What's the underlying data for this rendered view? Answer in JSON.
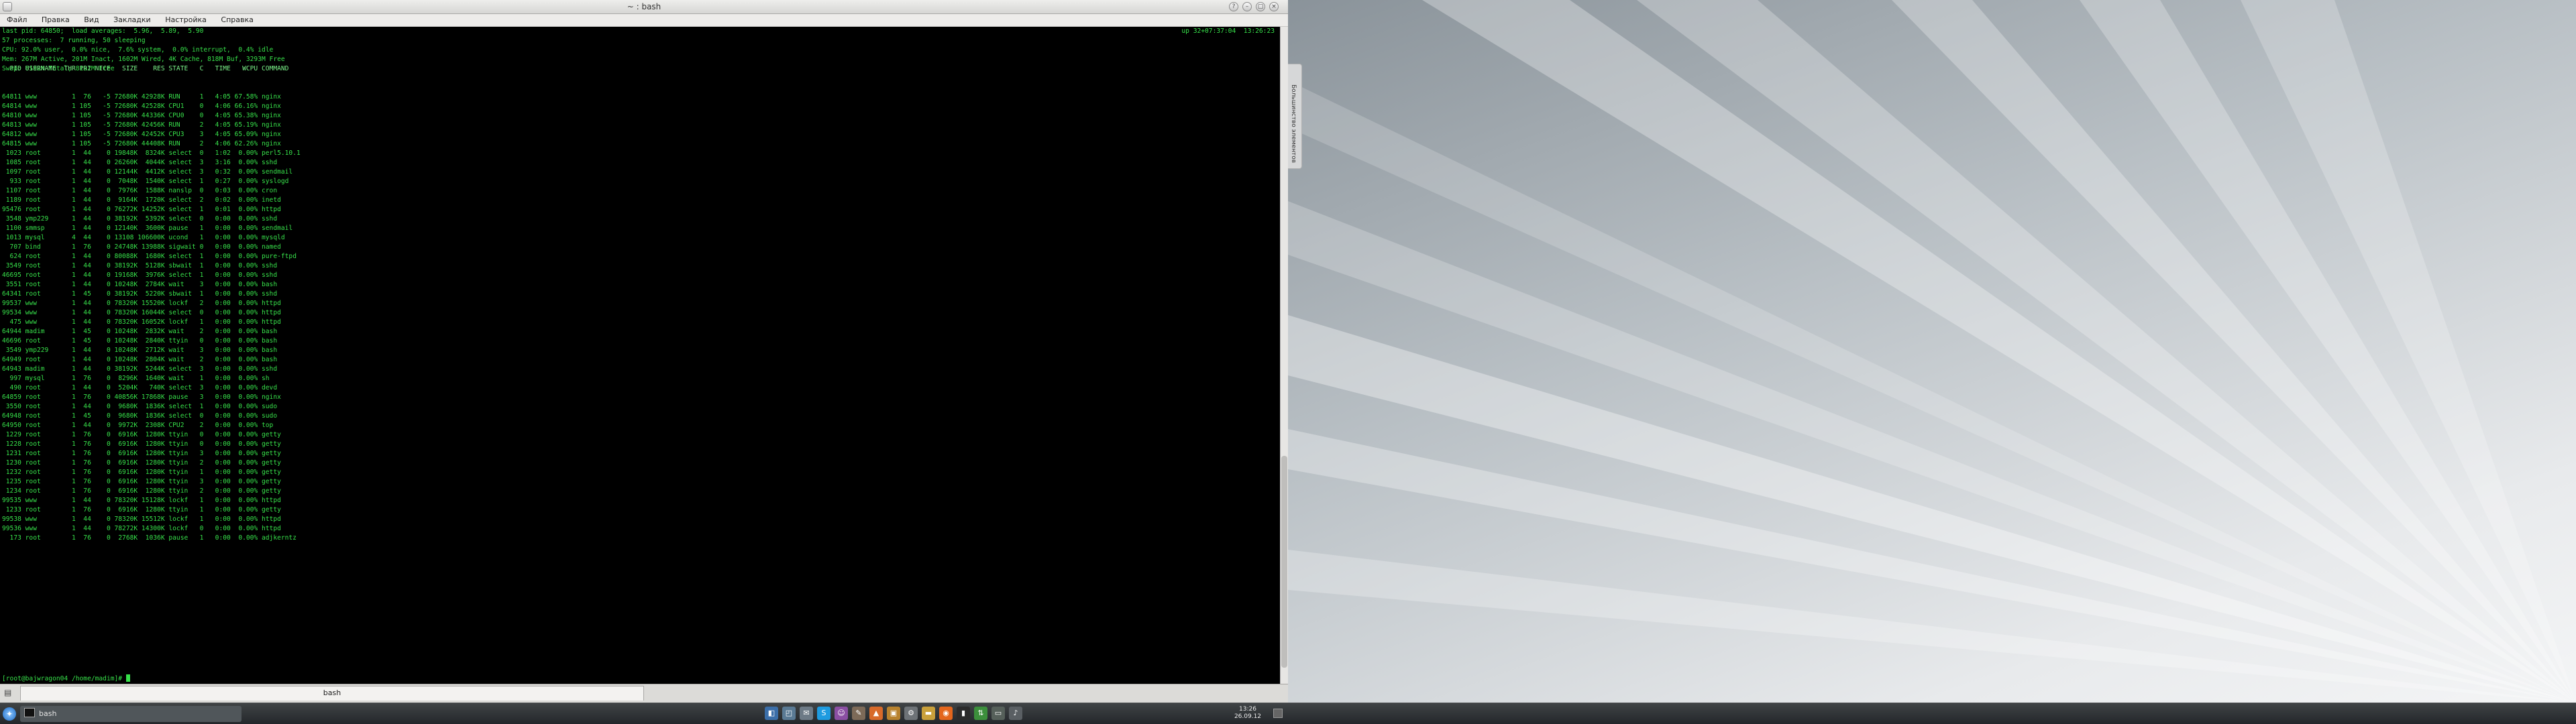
{
  "window": {
    "title": "~ : bash",
    "buttons": {
      "help": "?",
      "minimize": "–",
      "maximize": "▢",
      "close": "×"
    }
  },
  "menu": [
    "Файл",
    "Правка",
    "Вид",
    "Закладки",
    "Настройка",
    "Справка"
  ],
  "terminal": {
    "header_lines": [
      "last pid: 64850;  load averages:  5.96,  5.89,  5.90",
      "57 processes:  7 running, 50 sleeping",
      "CPU: 92.0% user,  0.0% nice,  7.6% system,  0.0% interrupt,  0.4% idle",
      "Mem: 267M Active, 201M Inact, 1602M Wired, 4K Cache, 818M Buf, 3293M Free",
      "Swap: 8192M Total, 8192M Free"
    ],
    "uptime": "up 32+07:37:04  13:26:23",
    "process_header": "  PID USERNAME  THR PRI NICE   SIZE    RES STATE   C   TIME   WCPU COMMAND",
    "process_rows": [
      "64811 www         1  76   -5 72680K 42928K RUN     1   4:05 67.58% nginx",
      "64814 www         1 105   -5 72680K 42528K CPU1    0   4:06 66.16% nginx",
      "64810 www         1 105   -5 72680K 44336K CPU0    0   4:05 65.38% nginx",
      "64813 www         1 105   -5 72680K 42456K RUN     2   4:05 65.19% nginx",
      "64812 www         1 105   -5 72680K 42452K CPU3    3   4:05 65.09% nginx",
      "64815 www         1 105   -5 72680K 44408K RUN     2   4:06 62.26% nginx",
      " 1023 root        1  44    0 19848K  8324K select  0   1:02  0.00% perl5.10.1",
      " 1085 root        1  44    0 26260K  4044K select  3   3:16  0.00% sshd",
      " 1097 root        1  44    0 12144K  4412K select  3   0:32  0.00% sendmail",
      "  933 root        1  44    0  7048K  1540K select  1   0:27  0.00% syslogd",
      " 1107 root        1  44    0  7976K  1588K nanslp  0   0:03  0.00% cron",
      " 1189 root        1  44    0  9164K  1720K select  2   0:02  0.00% inetd",
      "95476 root        1  44    0 76272K 14252K select  1   0:01  0.00% httpd",
      " 3548 ymp229      1  44    0 38192K  5392K select  0   0:00  0.00% sshd",
      " 1100 smmsp       1  44    0 12140K  3600K pause   1   0:00  0.00% sendmail",
      " 1013 mysql       4  44    0 13108 106600K ucond   1   0:00  0.00% mysqld",
      "  707 bind        1  76    0 24748K 13988K sigwait 0   0:00  0.00% named",
      "  624 root        1  44    0 80088K  1680K select  1   0:00  0.00% pure-ftpd",
      " 3549 root        1  44    0 38192K  5128K sbwait  1   0:00  0.00% sshd",
      "46695 root        1  44    0 19168K  3976K select  1   0:00  0.00% sshd",
      " 3551 root        1  44    0 10248K  2784K wait    3   0:00  0.00% bash",
      "64341 root        1  45    0 38192K  5220K sbwait  1   0:00  0.00% sshd",
      "99537 www         1  44    0 78320K 15520K lockf   2   0:00  0.00% httpd",
      "99534 www         1  44    0 78320K 16044K select  0   0:00  0.00% httpd",
      "  475 www         1  44    0 78320K 16052K lockf   1   0:00  0.00% httpd",
      "64944 madim       1  45    0 10248K  2832K wait    2   0:00  0.00% bash",
      "46696 root        1  45    0 10248K  2840K ttyin   0   0:00  0.00% bash",
      " 3549 ymp229      1  44    0 10248K  2712K wait    3   0:00  0.00% bash",
      "64949 root        1  44    0 10248K  2804K wait    2   0:00  0.00% bash",
      "64943 madim       1  44    0 38192K  5244K select  3   0:00  0.00% sshd",
      "  997 mysql       1  76    0  8296K  1640K wait    1   0:00  0.00% sh",
      "  490 root        1  44    0  5204K   740K select  3   0:00  0.00% devd",
      "64859 root        1  76    0 40856K 17868K pause   3   0:00  0.00% nginx",
      " 3550 root        1  44    0  9680K  1836K select  1   0:00  0.00% sudo",
      "64948 root        1  45    0  9680K  1836K select  0   0:00  0.00% sudo",
      "64950 root        1  44    0  9972K  2308K CPU2    2   0:00  0.00% top",
      " 1229 root        1  76    0  6916K  1280K ttyin   0   0:00  0.00% getty",
      " 1228 root        1  76    0  6916K  1280K ttyin   0   0:00  0.00% getty",
      " 1231 root        1  76    0  6916K  1280K ttyin   3   0:00  0.00% getty",
      " 1230 root        1  76    0  6916K  1280K ttyin   2   0:00  0.00% getty",
      " 1232 root        1  76    0  6916K  1280K ttyin   1   0:00  0.00% getty",
      " 1235 root        1  76    0  6916K  1280K ttyin   3   0:00  0.00% getty",
      " 1234 root        1  76    0  6916K  1280K ttyin   2   0:00  0.00% getty",
      "99535 www         1  44    0 78320K 15128K lockf   1   0:00  0.00% httpd",
      " 1233 root        1  76    0  6916K  1280K ttyin   1   0:00  0.00% getty",
      "99538 www         1  44    0 78320K 15512K lockf   1   0:00  0.00% httpd",
      "99536 www         1  44    0 78272K 14300K lockf   0   0:00  0.00% httpd",
      "  173 root        1  76    0  2768K  1036K pause   1   0:00  0.00% adjkerntz"
    ],
    "prompt": "[root@bajwragon04 /home/madim]# "
  },
  "tabs": {
    "new_tab_icon": "new-tab-icon",
    "active": "bash"
  },
  "desktop": {
    "widget_label": "Большинство элементов"
  },
  "taskbar": {
    "launcher_icon": "kde-launcher-icon",
    "task": "bash",
    "tray_icons": [
      {
        "name": "app-1-icon",
        "glyph": "◧",
        "color": "#3b6ea8"
      },
      {
        "name": "app-2-icon",
        "glyph": "◰",
        "color": "#5a7a94"
      },
      {
        "name": "mail-icon",
        "glyph": "✉",
        "color": "#6d7a86"
      },
      {
        "name": "skype-icon",
        "glyph": "S",
        "color": "#1e9be0"
      },
      {
        "name": "pidgin-icon",
        "glyph": "☺",
        "color": "#8b4fa3"
      },
      {
        "name": "tool-icon",
        "glyph": "✎",
        "color": "#7d6a58"
      },
      {
        "name": "flame-icon",
        "glyph": "▲",
        "color": "#d86a2a"
      },
      {
        "name": "brief-icon",
        "glyph": "▣",
        "color": "#b8822e"
      },
      {
        "name": "gear-icon",
        "glyph": "⚙",
        "color": "#6e7377"
      },
      {
        "name": "folder-icon",
        "glyph": "▬",
        "color": "#c9a03b"
      },
      {
        "name": "firefox-icon",
        "glyph": "◉",
        "color": "#e4661d"
      },
      {
        "name": "terminal-icon",
        "glyph": "▮",
        "color": "#2b2b2b"
      },
      {
        "name": "network-icon",
        "glyph": "⇅",
        "color": "#3c8f3c"
      },
      {
        "name": "battery-icon",
        "glyph": "▭",
        "color": "#56605a"
      },
      {
        "name": "volume-icon",
        "glyph": "♪",
        "color": "#5a5f63"
      }
    ],
    "clock": {
      "time": "13:26",
      "date": "26.09.12"
    }
  }
}
